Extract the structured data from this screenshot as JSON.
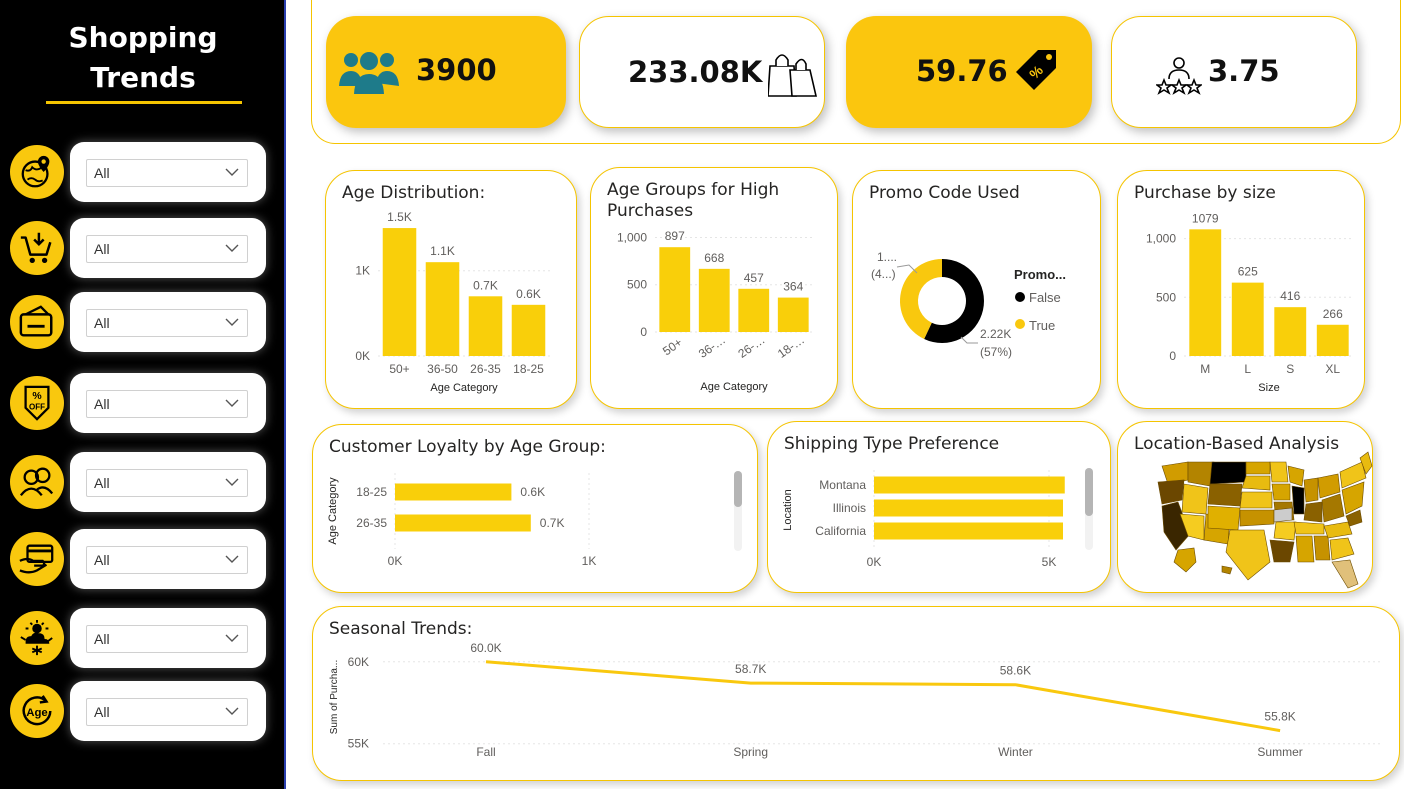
{
  "sidebar": {
    "title_line1": "Shopping",
    "title_line2": "Trends",
    "filters": [
      {
        "icon": "location-globe-icon",
        "value": "All"
      },
      {
        "icon": "shopping-cart-icon",
        "value": "All"
      },
      {
        "icon": "payment-card-icon",
        "value": "All"
      },
      {
        "icon": "discount-percent-icon",
        "value": "All"
      },
      {
        "icon": "gender-people-icon",
        "value": "All"
      },
      {
        "icon": "card-hand-icon",
        "value": "All"
      },
      {
        "icon": "season-weather-icon",
        "value": "All"
      },
      {
        "icon": "age-icon",
        "value": "All",
        "icon_text": "Age"
      }
    ]
  },
  "kpis": [
    {
      "value": "3900",
      "icon": "customers-group-icon",
      "style": "yellow"
    },
    {
      "value": "233.08K",
      "icon": "shopping-bags-icon",
      "style": "white"
    },
    {
      "value": "59.76",
      "icon": "price-tag-icon",
      "style": "yellow",
      "icon_text": "%"
    },
    {
      "value": "3.75",
      "icon": "rating-stars-icon",
      "style": "white"
    }
  ],
  "colors": {
    "accent": "#fbc60e",
    "bar": "#f9cf0a",
    "dark": "#000000",
    "line": "#f9c80e"
  },
  "charts": {
    "age_distribution": {
      "title": "Age Distribution:",
      "chart_data": {
        "type": "bar",
        "categories": [
          "50+",
          "36-50",
          "26-35",
          "18-25"
        ],
        "values": [
          1500,
          1100,
          700,
          600
        ],
        "data_labels": [
          "1.5K",
          "1.1K",
          "0.7K",
          "0.6K"
        ],
        "xlabel": "Age Category",
        "ylabel": "",
        "yticks": [
          "0K",
          "1K"
        ],
        "ylim": [
          0,
          1700
        ]
      }
    },
    "age_groups_high": {
      "title": "Age Groups for High Purchases",
      "chart_data": {
        "type": "bar",
        "categories": [
          "50+",
          "36-…",
          "26-…",
          "18-…"
        ],
        "values": [
          897,
          668,
          457,
          364
        ],
        "data_labels": [
          "897",
          "668",
          "457",
          "364"
        ],
        "xlabel": "Age Category",
        "yticks": [
          "0",
          "500",
          "1,000"
        ],
        "ylim": [
          0,
          1100
        ]
      }
    },
    "promo_code": {
      "title": "Promo Code Used",
      "chart_data": {
        "type": "pie",
        "legend_title": "Promo...",
        "slices": [
          {
            "label": "False",
            "value": 57,
            "color": "#000000",
            "data_label": "2.22K",
            "data_pct": "(57%)"
          },
          {
            "label": "True",
            "value": 43,
            "color": "#f9c80e",
            "data_label": "1....",
            "data_pct": "(4...)"
          }
        ],
        "legend_placement": "right"
      }
    },
    "purchase_by_size": {
      "title": "Purchase by size",
      "chart_data": {
        "type": "bar",
        "categories": [
          "M",
          "L",
          "S",
          "XL"
        ],
        "values": [
          1079,
          625,
          416,
          266
        ],
        "data_labels": [
          "1079",
          "625",
          "416",
          "266"
        ],
        "xlabel": "Size",
        "yticks": [
          "0",
          "500",
          "1,000"
        ],
        "ylim": [
          0,
          1150
        ]
      }
    },
    "loyalty_by_age": {
      "title": "Customer Loyalty by Age Group:",
      "chart_data": {
        "type": "bar",
        "orientation": "horizontal",
        "categories": [
          "18-25",
          "26-35"
        ],
        "values": [
          600,
          700
        ],
        "data_labels": [
          "0.6K",
          "0.7K"
        ],
        "ylabel": "Age Category",
        "xticks": [
          "0K",
          "1K"
        ],
        "xlim": [
          0,
          1000
        ]
      }
    },
    "shipping_type": {
      "title": "Shipping Type Preference",
      "chart_data": {
        "type": "bar",
        "orientation": "horizontal",
        "categories": [
          "Montana",
          "Illinois",
          "California"
        ],
        "values": [
          5450,
          5400,
          5400
        ],
        "ylabel": "Location",
        "xticks": [
          "0K",
          "5K"
        ],
        "xlim": [
          0,
          6000
        ]
      }
    },
    "location_analysis": {
      "title": "Location-Based Analysis",
      "chart_data": {
        "type": "heatmap",
        "note_type": "map"
      }
    },
    "seasonal_trends": {
      "title": "Seasonal Trends:",
      "chart_data": {
        "type": "line",
        "categories": [
          "Fall",
          "Spring",
          "Winter",
          "Summer"
        ],
        "values": [
          60000,
          58700,
          58600,
          55800
        ],
        "data_labels": [
          "60.0K",
          "58.7K",
          "58.6K",
          "55.8K"
        ],
        "ylabel": "Sum of Purcha...",
        "yticks": [
          "55K",
          "60K"
        ],
        "ylim": [
          54800,
          60900
        ]
      }
    }
  }
}
